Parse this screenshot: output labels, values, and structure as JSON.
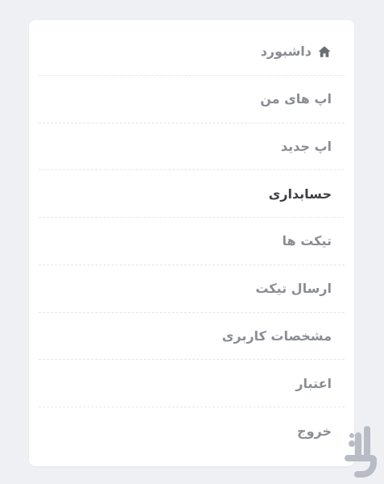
{
  "menu": {
    "items": [
      {
        "label": "داشبورد",
        "icon": "home-icon"
      },
      {
        "label": "اپ های من"
      },
      {
        "label": "اپ جدید"
      },
      {
        "label": "حسابداری",
        "active": true
      },
      {
        "label": "تیکت ها"
      },
      {
        "label": "ارسال تیکت"
      },
      {
        "label": "مشخصات کاربری"
      },
      {
        "label": "اعتبار"
      },
      {
        "label": "خروج"
      }
    ]
  },
  "colors": {
    "background": "#eef0f4",
    "card": "#ffffff",
    "item_text": "#8a8d93",
    "active_text": "#3d3f44",
    "logo": "#b8bcc4"
  },
  "logo": {
    "text": "بازار"
  }
}
